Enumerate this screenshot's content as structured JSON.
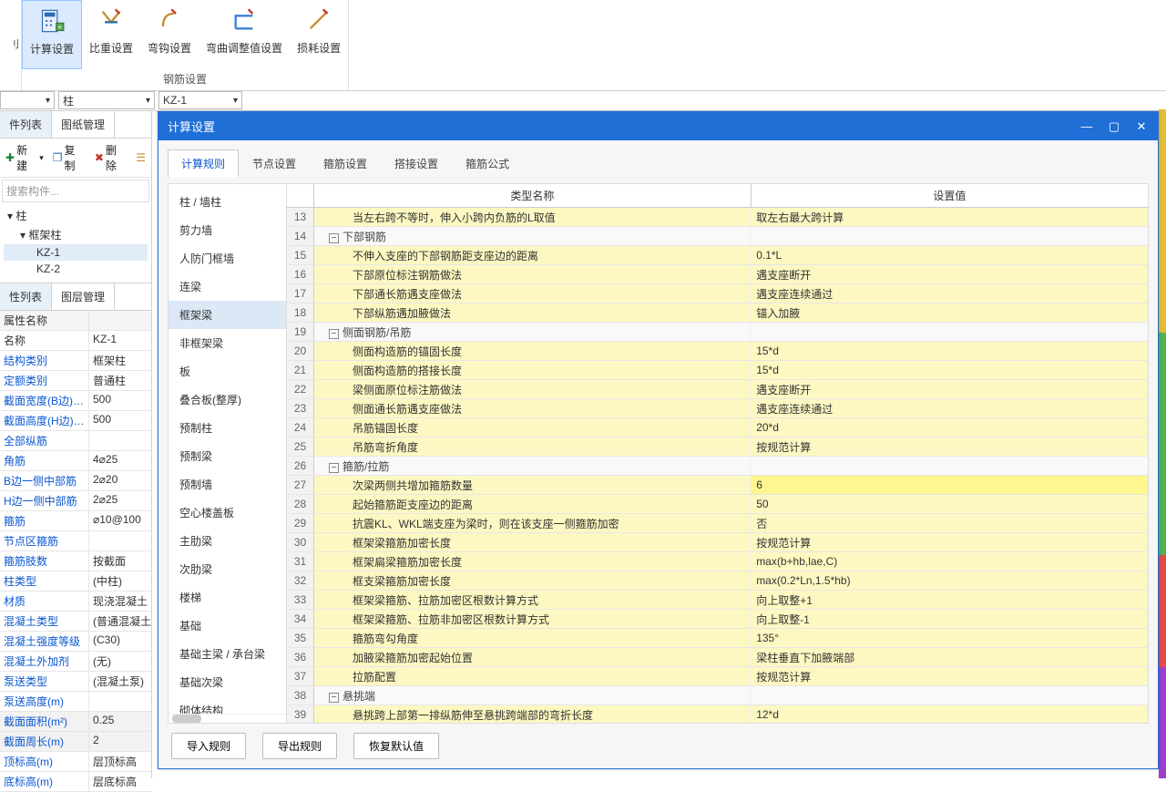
{
  "ribbon": {
    "group_label": "钢筋设置",
    "items": [
      {
        "label": "计算设置",
        "icon": "calc"
      },
      {
        "label": "比重设置",
        "icon": "weight"
      },
      {
        "label": "弯钩设置",
        "icon": "hook"
      },
      {
        "label": "弯曲调整值设置",
        "icon": "bend"
      },
      {
        "label": "损耗设置",
        "icon": "loss"
      }
    ]
  },
  "combos": {
    "c1": "",
    "c2": "柱",
    "c3": "KZ-1"
  },
  "left_tabs": {
    "t1": "件列表",
    "t2": "图纸管理"
  },
  "left_toolbar": {
    "new": "新建",
    "copy": "复制",
    "del": "删除"
  },
  "search_placeholder": "搜索构件...",
  "tree": {
    "n0": "柱",
    "n1": "框架柱",
    "n2": "KZ-1",
    "n3": "KZ-2"
  },
  "prop_tabs": {
    "t1": "性列表",
    "t2": "图层管理"
  },
  "prop_header": {
    "l": "属性名称",
    "r": ""
  },
  "props": [
    {
      "l": "名称",
      "r": "KZ-1",
      "blue": false
    },
    {
      "l": "结构类别",
      "r": "框架柱",
      "blue": true
    },
    {
      "l": "定额类别",
      "r": "普通柱",
      "blue": true
    },
    {
      "l": "截面宽度(B边)(...",
      "r": "500",
      "blue": true
    },
    {
      "l": "截面高度(H边)(...",
      "r": "500",
      "blue": true
    },
    {
      "l": "全部纵筋",
      "r": "",
      "blue": true
    },
    {
      "l": "角筋",
      "r": "4⌀25",
      "blue": true
    },
    {
      "l": "B边一侧中部筋",
      "r": "2⌀20",
      "blue": true
    },
    {
      "l": "H边一侧中部筋",
      "r": "2⌀25",
      "blue": true
    },
    {
      "l": "箍筋",
      "r": "⌀10@100",
      "blue": true
    },
    {
      "l": "节点区箍筋",
      "r": "",
      "blue": true
    },
    {
      "l": "箍筋肢数",
      "r": "按截面",
      "blue": true
    },
    {
      "l": "柱类型",
      "r": "(中柱)",
      "blue": true
    },
    {
      "l": "材质",
      "r": "现浇混凝土",
      "blue": true
    },
    {
      "l": "混凝土类型",
      "r": "(普通混凝土",
      "blue": true
    },
    {
      "l": "混凝土强度等级",
      "r": "(C30)",
      "blue": true
    },
    {
      "l": "混凝土外加剂",
      "r": "(无)",
      "blue": true
    },
    {
      "l": "泵送类型",
      "r": "(混凝土泵)",
      "blue": true
    },
    {
      "l": "泵送高度(m)",
      "r": "",
      "blue": true
    },
    {
      "l": "截面面积(m²)",
      "r": "0.25",
      "blue": true,
      "gray": true
    },
    {
      "l": "截面周长(m)",
      "r": "2",
      "blue": true,
      "gray": true
    },
    {
      "l": "顶标高(m)",
      "r": "层顶标高",
      "blue": true
    },
    {
      "l": "底标高(m)",
      "r": "层底标高",
      "blue": true
    }
  ],
  "dialog": {
    "title": "计算设置",
    "tabs": [
      "计算规则",
      "节点设置",
      "箍筋设置",
      "搭接设置",
      "箍筋公式"
    ],
    "categories": [
      "柱 / 墙柱",
      "剪力墙",
      "人防门框墙",
      "连梁",
      "框架梁",
      "非框架梁",
      "板",
      "叠合板(整厚)",
      "预制柱",
      "预制梁",
      "预制墙",
      "空心楼盖板",
      "主肋梁",
      "次肋梁",
      "楼梯",
      "基础",
      "基础主梁 / 承台梁",
      "基础次梁",
      "砌体结构"
    ],
    "cat_selected": 4,
    "header": {
      "name": "类型名称",
      "val": "设置值"
    },
    "rules": [
      {
        "n": 13,
        "name": "当左右跨不等时，伸入小跨内负筋的L取值",
        "val": "取左右最大跨计算",
        "indent": true,
        "edit": true
      },
      {
        "n": 14,
        "name": "下部钢筋",
        "group": true
      },
      {
        "n": 15,
        "name": "不伸入支座的下部钢筋距支座边的距离",
        "val": "0.1*L",
        "indent": true,
        "edit": true
      },
      {
        "n": 16,
        "name": "下部原位标注钢筋做法",
        "val": "遇支座断开",
        "indent": true,
        "edit": true
      },
      {
        "n": 17,
        "name": "下部通长筋遇支座做法",
        "val": "遇支座连续通过",
        "indent": true,
        "edit": true
      },
      {
        "n": 18,
        "name": "下部纵筋遇加腋做法",
        "val": "锚入加腋",
        "indent": true,
        "edit": true
      },
      {
        "n": 19,
        "name": "侧面钢筋/吊筋",
        "group": true
      },
      {
        "n": 20,
        "name": "侧面构造筋的锚固长度",
        "val": "15*d",
        "indent": true,
        "edit": true
      },
      {
        "n": 21,
        "name": "侧面构造筋的搭接长度",
        "val": "15*d",
        "indent": true,
        "edit": true
      },
      {
        "n": 22,
        "name": "梁侧面原位标注筋做法",
        "val": "遇支座断开",
        "indent": true,
        "edit": true
      },
      {
        "n": 23,
        "name": "侧面通长筋遇支座做法",
        "val": "遇支座连续通过",
        "indent": true,
        "edit": true
      },
      {
        "n": 24,
        "name": "吊筋锚固长度",
        "val": "20*d",
        "indent": true,
        "edit": true
      },
      {
        "n": 25,
        "name": "吊筋弯折角度",
        "val": "按规范计算",
        "indent": true,
        "edit": true
      },
      {
        "n": 26,
        "name": "箍筋/拉筋",
        "group": true
      },
      {
        "n": 27,
        "name": "次梁两侧共增加箍筋数量",
        "val": "6",
        "indent": true,
        "edit": true,
        "hl": true
      },
      {
        "n": 28,
        "name": "起始箍筋距支座边的距离",
        "val": "50",
        "indent": true,
        "edit": true
      },
      {
        "n": 29,
        "name": "抗震KL、WKL端支座为梁时，则在该支座一侧箍筋加密",
        "val": "否",
        "indent": true,
        "edit": true
      },
      {
        "n": 30,
        "name": "框架梁箍筋加密长度",
        "val": "按规范计算",
        "indent": true,
        "edit": true
      },
      {
        "n": 31,
        "name": "框架扁梁箍筋加密长度",
        "val": "max(b+hb,lae,C)",
        "indent": true,
        "edit": true
      },
      {
        "n": 32,
        "name": "框支梁箍筋加密长度",
        "val": "max(0.2*Ln,1.5*hb)",
        "indent": true,
        "edit": true
      },
      {
        "n": 33,
        "name": "框架梁箍筋、拉筋加密区根数计算方式",
        "val": "向上取整+1",
        "indent": true,
        "edit": true
      },
      {
        "n": 34,
        "name": "框架梁箍筋、拉筋非加密区根数计算方式",
        "val": "向上取整-1",
        "indent": true,
        "edit": true
      },
      {
        "n": 35,
        "name": "箍筋弯勾角度",
        "val": "135°",
        "indent": true,
        "edit": true
      },
      {
        "n": 36,
        "name": "加腋梁箍筋加密起始位置",
        "val": "梁柱垂直下加腋端部",
        "indent": true,
        "edit": true
      },
      {
        "n": 37,
        "name": "拉筋配置",
        "val": "按规范计算",
        "indent": true,
        "edit": true
      },
      {
        "n": 38,
        "name": "悬挑端",
        "group": true
      },
      {
        "n": 39,
        "name": "悬挑跨上部第一排纵筋伸至悬挑跨端部的弯折长度",
        "val": "12*d",
        "indent": true,
        "edit": true
      }
    ],
    "buttons": {
      "import": "导入规则",
      "export": "导出规则",
      "reset": "恢复默认值"
    }
  }
}
